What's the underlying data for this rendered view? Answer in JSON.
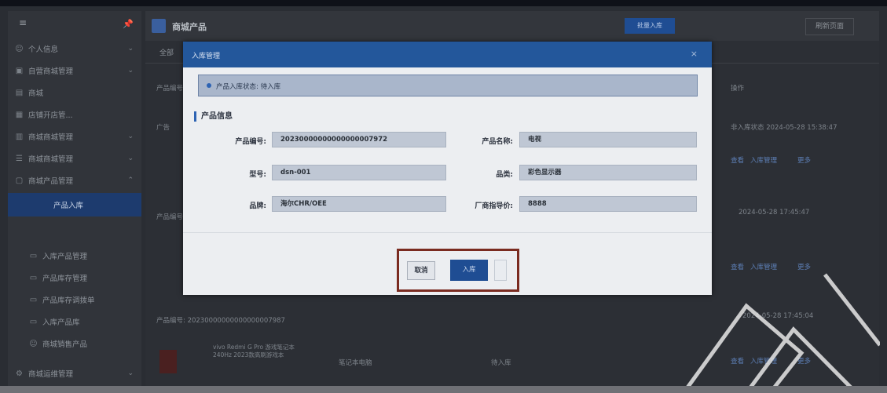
{
  "sidebar": {
    "items": [
      {
        "label": "个人信息",
        "icon": "user-icon"
      },
      {
        "label": "自营商城管理",
        "icon": "store-icon"
      },
      {
        "label": "商城",
        "icon": "mall-icon"
      },
      {
        "label": "店铺开店管...",
        "icon": "shop-icon"
      },
      {
        "label": "商城商城管理",
        "icon": "grid-icon"
      },
      {
        "label": "商城商城管理",
        "icon": "list-icon"
      },
      {
        "label": "商城产品管理",
        "icon": "box-icon"
      },
      {
        "label": "产品入库",
        "icon": "inbox-icon",
        "active": true
      },
      {
        "label": "入库产品管理",
        "icon": "doc-icon"
      },
      {
        "label": "产品库存管理",
        "icon": "doc-icon"
      },
      {
        "label": "产品库存调拨单",
        "icon": "doc-icon"
      },
      {
        "label": "入库产品库",
        "icon": "doc-icon"
      },
      {
        "label": "商城销售产品",
        "icon": "user-icon"
      },
      {
        "label": "商城运维管理",
        "icon": "settings-icon"
      }
    ]
  },
  "main": {
    "title": "商城产品",
    "primary_button": "批量入库",
    "secondary_button": "刷新页面",
    "tab": "全部",
    "rows": [
      {
        "label": "产品编号",
        "right_text": "操作"
      },
      {
        "label": "广告",
        "right_text": "非入库状态 2024-05-28 15:38:47"
      },
      {
        "label": "产品编号",
        "right_text": "2024-05-28 17:45:47"
      },
      {
        "code": "产品编号: 20230000000000000007987",
        "right_text": "2024-05-28 17:45:04"
      },
      {
        "name": "vivo Redmi G Pro 游戏笔记本 240Hz 2023款高刷游戏本",
        "category": "笔记本电脑",
        "status": "待入库"
      }
    ],
    "links": [
      "查看",
      "入库管理",
      "更多"
    ]
  },
  "modal": {
    "title": "入库管理",
    "status_text": "产品入库状态: 待入库",
    "section_title": "产品信息",
    "fields": [
      {
        "label": "产品编号:",
        "value": "20230000000000000007972"
      },
      {
        "label": "产品名称:",
        "value": "电视"
      },
      {
        "label": "型号:",
        "value": "dsn-001"
      },
      {
        "label": "品类:",
        "value": "彩色显示器"
      },
      {
        "label": "品牌:",
        "value": "海尔CHR/OEE"
      },
      {
        "label": "厂商指导价:",
        "value": "8888"
      }
    ],
    "cancel_label": "取消",
    "confirm_label": "入库"
  },
  "colors": {
    "accent": "#23579b",
    "highlight_border": "#7a2b20",
    "sidebar_active": "#1d3b6e"
  }
}
